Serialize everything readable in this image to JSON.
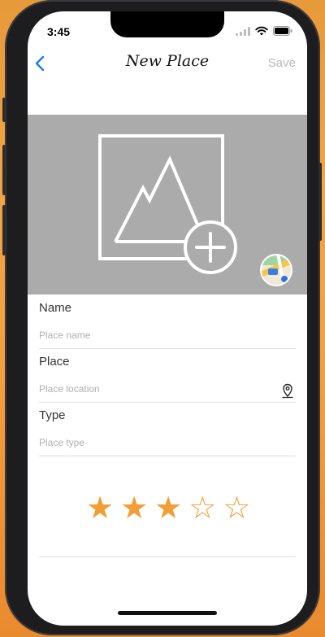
{
  "status_bar": {
    "time": "3:45"
  },
  "navbar": {
    "title": "New Place",
    "save_label": "Save"
  },
  "fields": [
    {
      "label": "Name",
      "placeholder": "Place name",
      "value": ""
    },
    {
      "label": "Place",
      "placeholder": "Place location",
      "value": ""
    },
    {
      "label": "Type",
      "placeholder": "Place type",
      "value": ""
    }
  ],
  "rating": {
    "stars": [
      "★",
      "★",
      "★",
      "☆",
      "☆"
    ],
    "value": 3,
    "max": 5
  },
  "colors": {
    "accent": "#f29d35",
    "link": "#1a7cf0",
    "image_placeholder": "#ababab",
    "save_disabled": "#b8b8b8"
  },
  "icons": {
    "back": "chevron-left-icon",
    "add_photo": "add-photo-icon",
    "map": "maps-app-icon",
    "pin": "location-pin-icon"
  }
}
